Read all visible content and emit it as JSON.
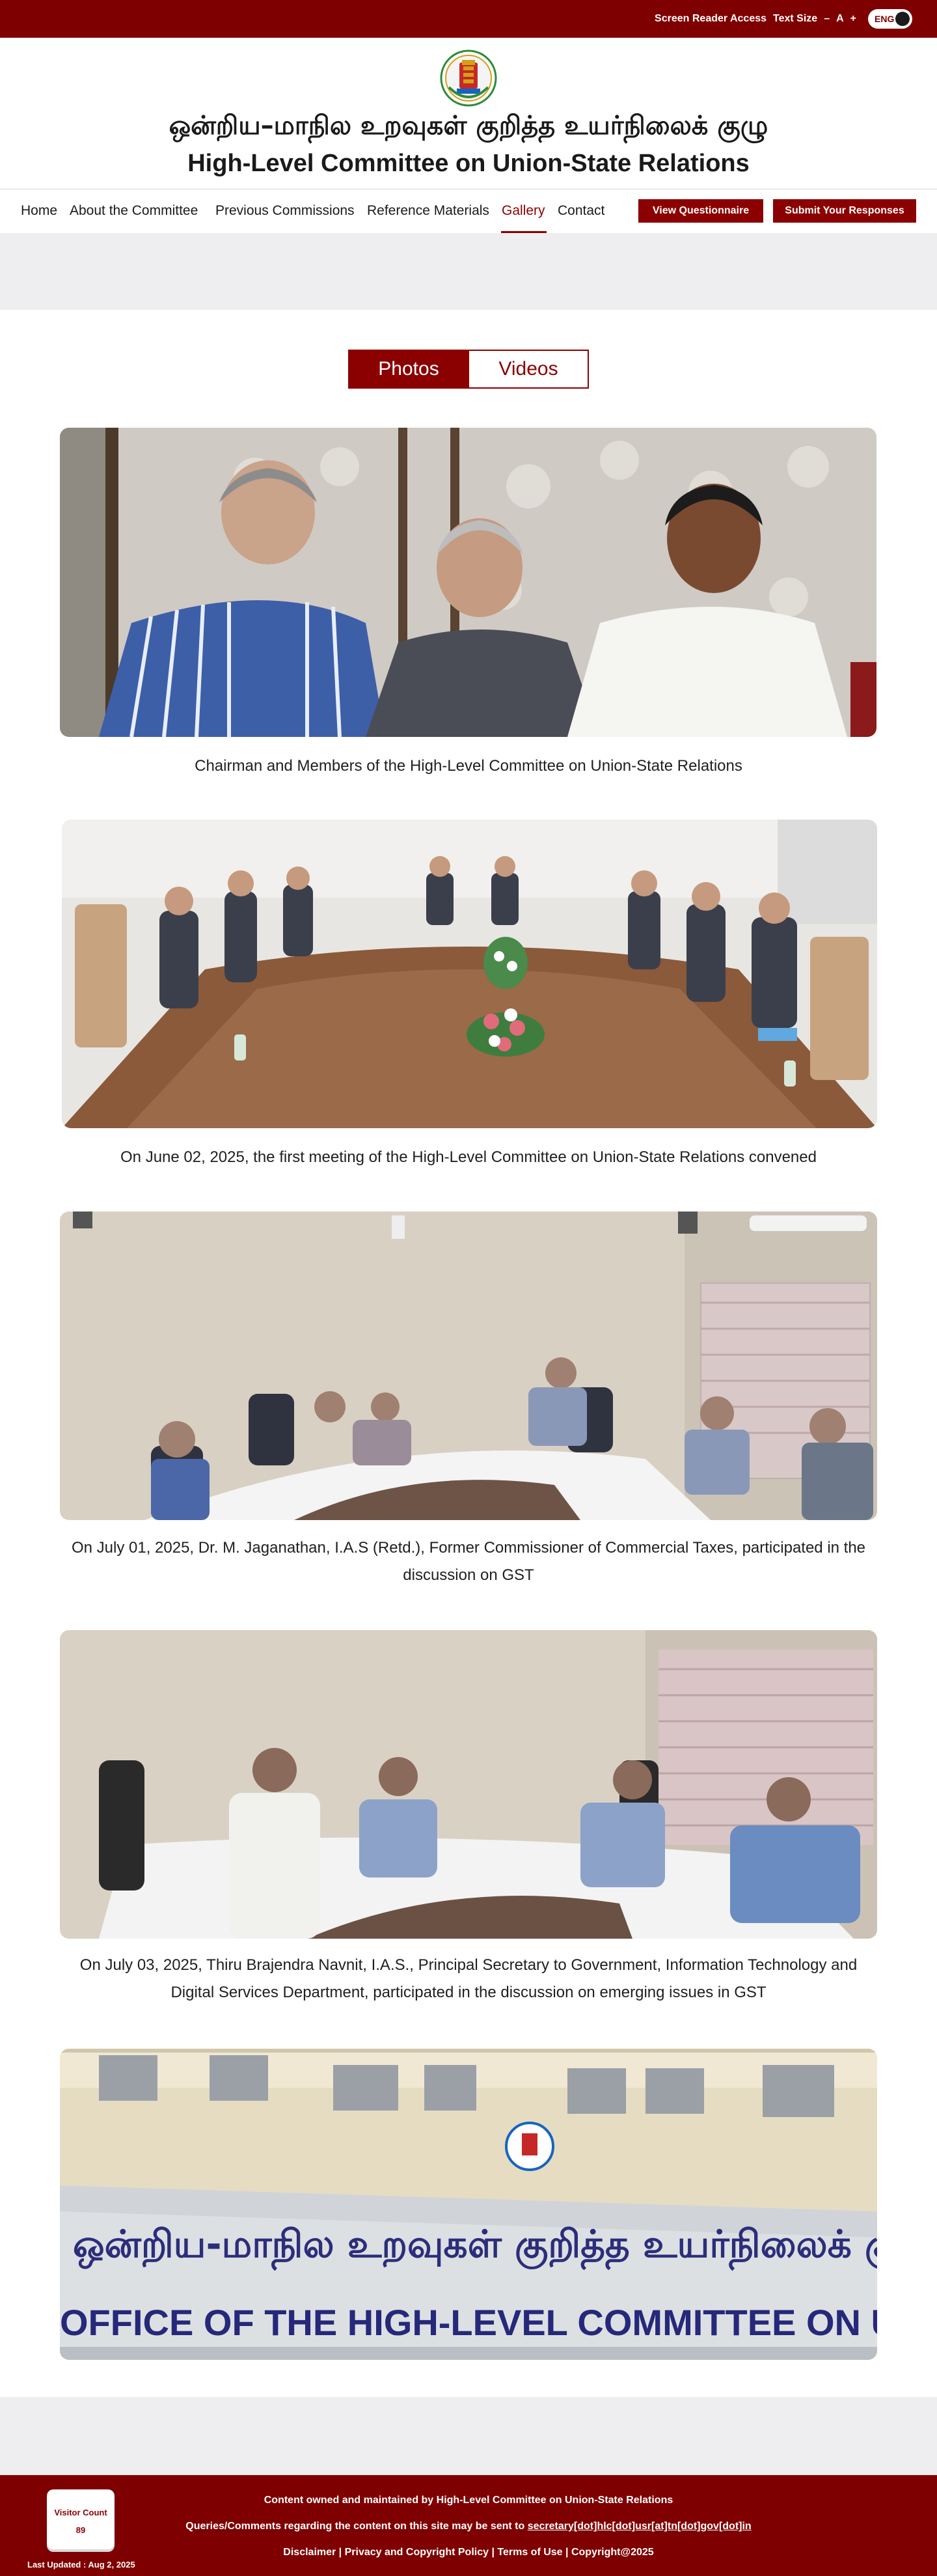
{
  "topbar": {
    "screen_reader": "Screen Reader Access",
    "text_size": "Text Size",
    "size_decrease": "–",
    "size_normal": "A",
    "size_increase": "+",
    "language": "ENG"
  },
  "header": {
    "title_tamil": "ஒன்றிய–மாநில உறவுகள் குறித்த  உயர்நிலைக் குழு",
    "title_english": "High-Level Committee on Union-State Relations"
  },
  "nav": {
    "items": [
      "Home",
      "About the Committee",
      "Previous Commissions",
      "Reference Materials",
      "Gallery",
      "Contact"
    ],
    "active": "Gallery",
    "view_questionnaire": "View Questionnaire",
    "submit_responses": "Submit Your Responses"
  },
  "tabs": {
    "photos": "Photos",
    "videos": "Videos",
    "active": "Photos"
  },
  "gallery": [
    {
      "caption": "Chairman and Members of the High-Level Committee on Union-State Relations"
    },
    {
      "caption": "On June 02, 2025, the first meeting of the High-Level Committee on Union-State Relations convened"
    },
    {
      "caption": "On July 01, 2025, Dr. M. Jaganathan, I.A.S (Retd.), Former Commissioner of Commercial Taxes, participated in the discussion on GST"
    },
    {
      "caption": "On July 03, 2025, Thiru Brajendra Navnit, I.A.S., Principal Secretary to Government, Information Technology and Digital Services Department, participated in the discussion on emerging issues in GST"
    },
    {
      "sign_tamil": "ஒன்றிய-மாநில உறவுகள் குறித்த உயர்நிலைக் குழு அலுவலகம்",
      "sign_english": "OFFICE OF THE HIGH-LEVEL COMMITTEE ON UNION-STATE RELATIO"
    }
  ],
  "footer": {
    "visitor_label": "Visitor Count",
    "visitor_count": "89",
    "last_updated": "Last Updated : Aug 2, 2025",
    "line1": "Content owned and maintained by High-Level Committee on Union-State Relations",
    "line2_prefix": "Queries/Comments regarding the content on this site may be sent to ",
    "line2_email": "secretary[dot]hlc[dot]usr[at]tn[dot]gov[dot]in",
    "links": [
      "Disclaimer",
      "Privacy and Copyright Policy",
      "Terms of Use",
      "Copyright@2025"
    ],
    "separator": " | "
  },
  "colors": {
    "brand": "#7e0000",
    "accent": "#8b0000"
  }
}
